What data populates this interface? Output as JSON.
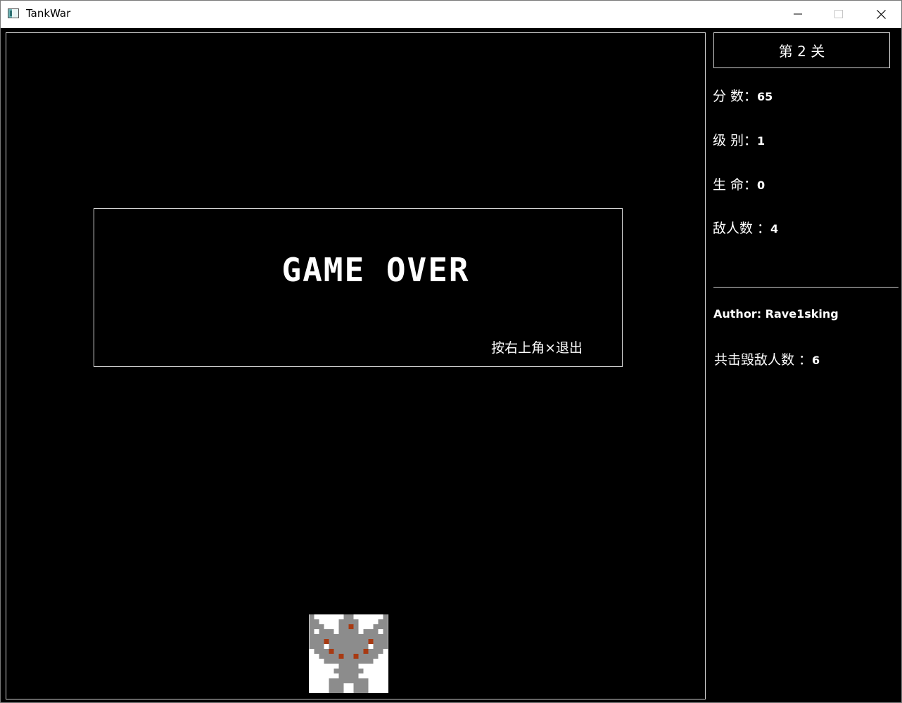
{
  "window": {
    "title": "TankWar",
    "min_label": "minimize",
    "max_label": "maximize",
    "close_label": "close"
  },
  "battlefield": {
    "gameover_title": "GAME OVER",
    "gameover_hint": "按右上角×退出"
  },
  "sidebar": {
    "level_label": "第 2 关",
    "score_label": "分 数：",
    "score_value": "65",
    "rank_label": "级 别：",
    "rank_value": "1",
    "lives_label": "生 命：",
    "lives_value": "0",
    "enemies_label": "敌人数 ：",
    "enemies_value": "4",
    "author": "Author: Rave1sking",
    "destroyed_label": "共击毁敌人数 ：",
    "destroyed_value": "6"
  },
  "icons": {
    "app": "tank-app-icon",
    "base": "eagle-base-icon"
  },
  "colors": {
    "background": "#000000",
    "text": "#ffffff",
    "border": "#cfcfcf",
    "eagle_gray": "#8c8c8c",
    "eagle_red": "#a83a12"
  }
}
